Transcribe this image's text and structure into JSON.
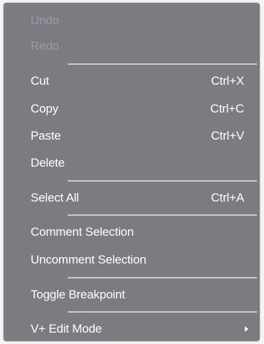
{
  "menu": {
    "items": [
      {
        "label": "Undo",
        "shortcut": "",
        "enabled": false
      },
      {
        "label": "Redo",
        "shortcut": "",
        "enabled": false
      },
      {
        "label": "Cut",
        "shortcut": "Ctrl+X",
        "enabled": true
      },
      {
        "label": "Copy",
        "shortcut": "Ctrl+C",
        "enabled": true
      },
      {
        "label": "Paste",
        "shortcut": "Ctrl+V",
        "enabled": true
      },
      {
        "label": "Delete",
        "shortcut": "",
        "enabled": true
      },
      {
        "label": "Select All",
        "shortcut": "Ctrl+A",
        "enabled": true
      },
      {
        "label": "Comment Selection",
        "shortcut": "",
        "enabled": true
      },
      {
        "label": "Uncomment Selection",
        "shortcut": "",
        "enabled": true
      },
      {
        "label": "Toggle Breakpoint",
        "shortcut": "",
        "enabled": true
      },
      {
        "label": "V+ Edit Mode",
        "shortcut": "",
        "enabled": true,
        "submenu": true
      }
    ]
  },
  "colors": {
    "menu_background": "#7b7b82",
    "text": "#ffffff",
    "disabled_text": "#9a9aa2",
    "separator": "#c9c9cf"
  }
}
